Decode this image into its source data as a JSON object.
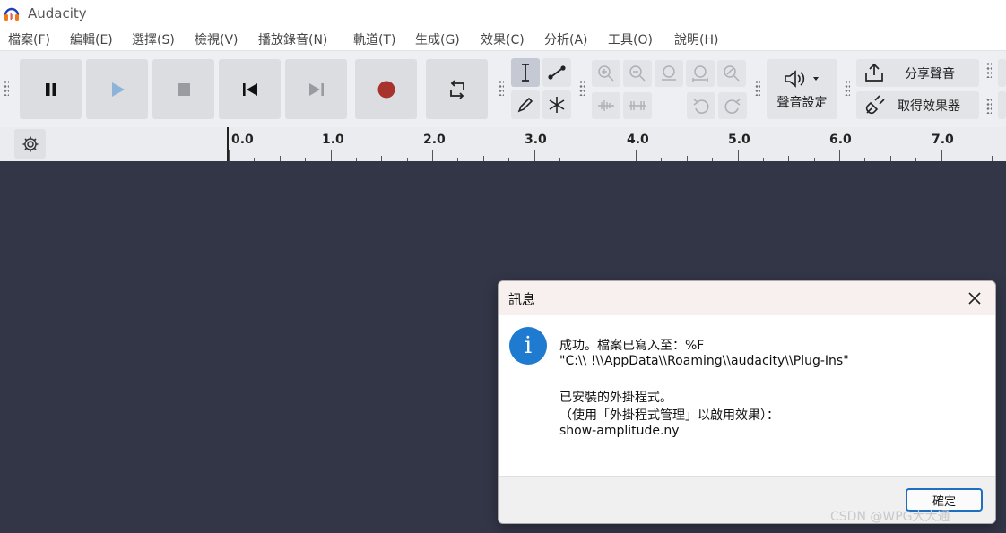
{
  "window": {
    "title": "Audacity"
  },
  "menu": [
    {
      "label": "檔案(F)"
    },
    {
      "label": "編輯(E)"
    },
    {
      "label": "選擇(S)"
    },
    {
      "label": "檢視(V)"
    },
    {
      "label": "播放錄音(N)"
    },
    {
      "label": "軌道(T)"
    },
    {
      "label": "生成(G)"
    },
    {
      "label": "效果(C)"
    },
    {
      "label": "分析(A)"
    },
    {
      "label": "工具(O)"
    },
    {
      "label": "說明(H)"
    }
  ],
  "transport": {
    "icons": [
      "pause-icon",
      "play-icon",
      "stop-icon",
      "skip-start-icon",
      "skip-end-icon",
      "record-icon",
      "loop-icon"
    ]
  },
  "tools": {
    "icons": [
      "selection-tool-icon",
      "envelope-tool-icon",
      "draw-tool-icon",
      "multi-tool-icon"
    ]
  },
  "edit_tools": {
    "icons": [
      "zoom-in-icon",
      "zoom-out-icon",
      "fit-selection-icon",
      "fit-project-icon",
      "zoom-toggle-icon",
      "trim-audio-icon",
      "silence-audio-icon",
      "undo-icon",
      "redo-icon"
    ]
  },
  "audio_setup": {
    "label": "聲音設定"
  },
  "share_audio": {
    "label": "分享聲音"
  },
  "get_effects": {
    "label": "取得效果器"
  },
  "ruler": {
    "labels": [
      "0.0",
      "1.0",
      "2.0",
      "3.0",
      "4.0",
      "5.0",
      "6.0",
      "7.0"
    ]
  },
  "dialog": {
    "title": "訊息",
    "line1": "成功。檔案已寫入至：%F",
    "line2": "\"C:\\\\                            !\\\\AppData\\\\Roaming\\\\audacity\\\\Plug-Ins\"",
    "line3": "已安裝的外掛程式。",
    "line4": "（使用「外掛程式管理」以啟用效果）：",
    "line5": "show-amplitude.ny",
    "ok_label": "確定",
    "info_glyph": "i"
  },
  "watermark": "CSDN @WPG大大通",
  "colors": {
    "record": "#a8322d",
    "track_background": "#333647",
    "info_icon": "#1f7bd0",
    "ok_border": "#1f6fc0"
  }
}
